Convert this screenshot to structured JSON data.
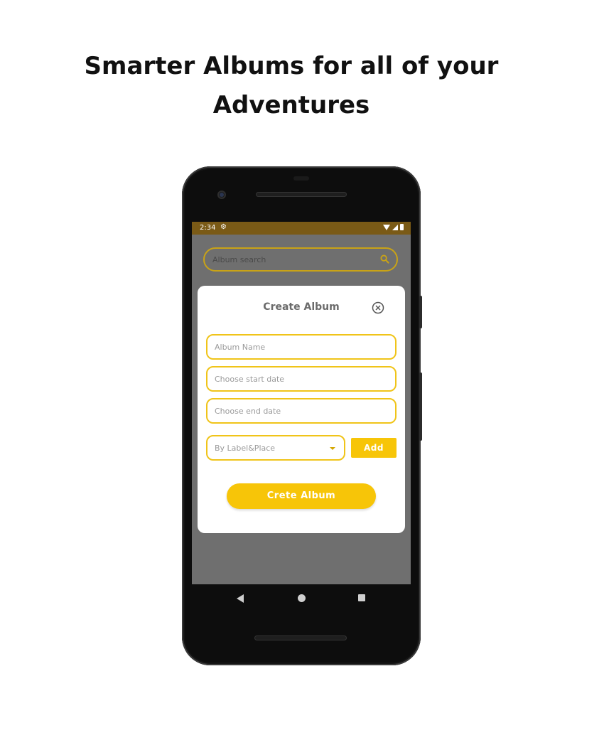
{
  "headline": {
    "line1": "Smarter Albums for all of your",
    "line2": "Adventures"
  },
  "status_bar": {
    "time": "2:34",
    "icons": [
      "settings-gear-icon",
      "wifi-icon",
      "signal-icon",
      "battery-icon"
    ],
    "color": "#7a5a16"
  },
  "search": {
    "placeholder": "Album search",
    "icon": "search-icon"
  },
  "dialog": {
    "title": "Create Album",
    "close_icon": "close-circle-icon",
    "fields": {
      "album_name_placeholder": "Album Name",
      "start_date_placeholder": "Choose start date",
      "end_date_placeholder": "Choose end date"
    },
    "dropdown": {
      "selected": "By Label&Place",
      "icon": "chevron-down-icon"
    },
    "add_label": "Add",
    "create_label": "Crete Album"
  },
  "nav_bar": {
    "icons": [
      "back-icon",
      "home-icon",
      "recents-icon"
    ]
  },
  "colors": {
    "accent": "#f7c508",
    "field_border": "#f0c419",
    "overlay": "#6f6f6f"
  }
}
